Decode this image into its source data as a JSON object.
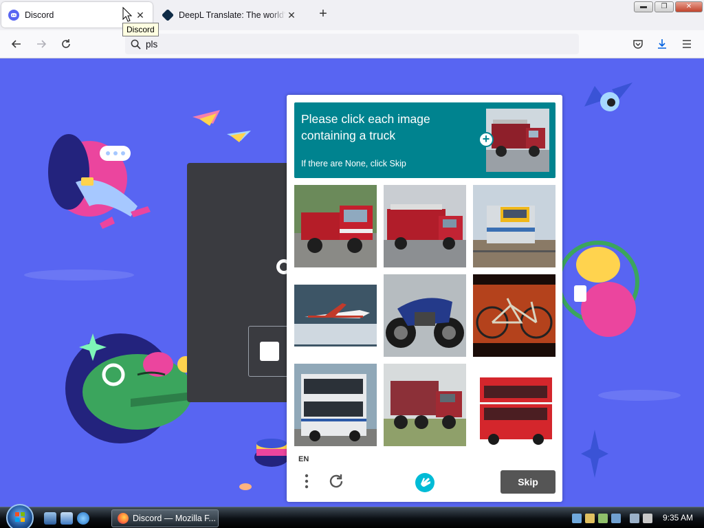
{
  "browser": {
    "tabs": [
      {
        "title": "Discord",
        "active": true
      },
      {
        "title": "DeepL Translate: The world's most accurate translator",
        "active": false
      }
    ],
    "tooltip": "Discord",
    "url_text": "pls"
  },
  "captcha": {
    "prompt": "Please click each image containing a truck",
    "subtext": "If there are None, click Skip",
    "language": "EN",
    "skip_label": "Skip",
    "accent_color": "#00838f",
    "tiles": [
      {
        "subject": "truck"
      },
      {
        "subject": "truck"
      },
      {
        "subject": "train"
      },
      {
        "subject": "airplane"
      },
      {
        "subject": "motorcycle"
      },
      {
        "subject": "bicycle"
      },
      {
        "subject": "bus"
      },
      {
        "subject": "truck"
      },
      {
        "subject": "bus"
      }
    ]
  },
  "taskbar": {
    "task_label": "Discord — Mozilla F...",
    "clock": "9:35 AM"
  }
}
